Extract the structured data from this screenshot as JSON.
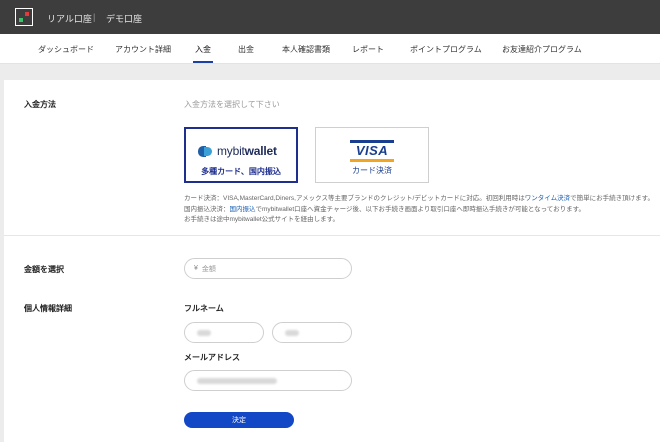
{
  "header": {
    "real_account": "リアル口座",
    "separator": "|",
    "demo_account": "デモ口座"
  },
  "nav": {
    "items": [
      {
        "label": "ダッシュボード"
      },
      {
        "label": "アカウント詳細"
      },
      {
        "label": "入金",
        "active": true
      },
      {
        "label": "出金"
      },
      {
        "label": "本人確認書類"
      },
      {
        "label": "レポート"
      },
      {
        "label": "ポイントプログラム"
      },
      {
        "label": "お友達紹介プログラム"
      }
    ]
  },
  "deposit": {
    "method_label": "入金方法",
    "method_hint": "入金方法を選択して下さい",
    "methods": [
      {
        "name": "mybitwallet",
        "logo_text_light": "mybit",
        "logo_text_bold": "wallet",
        "caption": "多種カード、国内振込",
        "selected": true
      },
      {
        "name": "visa",
        "logo_text": "VISA",
        "caption": "カード決済",
        "selected": false
      }
    ],
    "description": {
      "line1_a": "カード決済：VISA,MasterCard,Diners,アメックス等主要ブランドのクレジット/デビットカードに対応。初回利用時は",
      "line1_link": "ワンタイム決済",
      "line1_b": "で簡単にお手続き頂けます。",
      "line2_a": "国内振込決済：",
      "line2_link": "国内振込",
      "line2_b": "でmybitwallet口座へ資金チャージ後、以下お手続き画面より取引口座へ即時振込手続きが可能となっております。",
      "line3": "お手続きは途中mybitwallet公式サイトを経由します。"
    },
    "amount_label": "金額を選択",
    "amount_icon": "yen-icon",
    "amount_placeholder": "金額",
    "personal_label": "個人情報詳細",
    "fullname_label": "フルネーム",
    "email_label": "メールアドレス",
    "submit_label": "決定"
  },
  "colors": {
    "topbar": "#3d3d3d",
    "accent": "#1f2f8e",
    "submit": "#1247c6",
    "link": "#1a5fb4"
  }
}
